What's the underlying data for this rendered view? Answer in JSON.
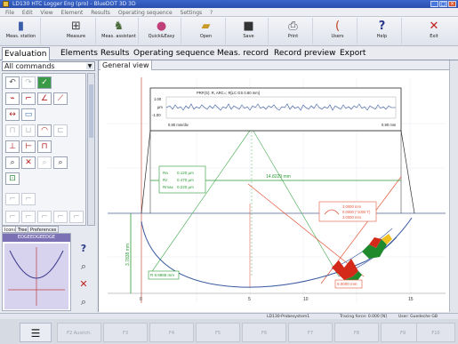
{
  "window": {
    "title": "LD130 HTC Logger Eng (pro) - BlueDOT 3D 3D",
    "controls": {
      "min": "_",
      "max": "□",
      "close": "×"
    }
  },
  "menu": [
    "File",
    "Edit",
    "View",
    "Element",
    "Results",
    "Operating sequence",
    "Settings",
    "?"
  ],
  "toolbar": [
    {
      "label": "Meas. station",
      "icon": "meas-station-icon"
    },
    {
      "label": "Measure",
      "icon": "measure-icon"
    },
    {
      "label": "Meas. assistant",
      "icon": "assistant-icon"
    },
    {
      "label": "Quick&Easy",
      "icon": "quick-easy-icon"
    },
    {
      "label": "Open",
      "icon": "open-icon"
    },
    {
      "label": "Save",
      "icon": "save-icon"
    },
    {
      "label": "Print",
      "icon": "print-icon"
    },
    {
      "label": "Users",
      "icon": "users-icon"
    },
    {
      "label": "Help",
      "icon": "help-icon"
    },
    {
      "label": "Exit",
      "icon": "exit-icon"
    }
  ],
  "tabs": [
    "Evaluation",
    "Elements",
    "Results",
    "Operating sequence",
    "Meas. record",
    "Record preview",
    "Export"
  ],
  "active_tab": "Evaluation",
  "commands_dropdown": "All commands",
  "view_title": "General view",
  "subtabs": [
    "Icons",
    "Tree",
    "Preferences"
  ],
  "thumbnail_header": "EDGEEDGEEDGE",
  "profile_inset": {
    "title": "PRF(G): R, ARC=; R[LC GS 0.80 mm]",
    "y_top": "1.00",
    "y_unit": "µm",
    "y_bottom": "-1.00",
    "x_left": "0.80 mm/div",
    "x_right": "0.90 mm"
  },
  "measure_box": {
    "rows": [
      {
        "label": "Ra",
        "value": "0.120 µm"
      },
      {
        "label": "Rz",
        "value": "0.470 µm"
      },
      {
        "label": "Rmax",
        "value": "0.220 µm"
      }
    ]
  },
  "dimensions": {
    "horizontal": "14.8229 mm",
    "vertical": "3.7838 mm",
    "radius": "R 8.9988 mm",
    "arc_box": [
      "3.0000 mm",
      "0.0000 (*1000 T)",
      "3.0000 mm"
    ],
    "corner": "9.0000 mm"
  },
  "axis_ticks": [
    "0",
    "5",
    "10",
    "15"
  ],
  "status": {
    "system": "LD130-Probesystem1",
    "force": "Tracing force: 0.000 [N]",
    "user": "User: Guedeche GB"
  },
  "fkeys": [
    "F2 Ausrich.",
    "F3",
    "F4",
    "F5",
    "F6",
    "F7",
    "F8",
    "F9",
    "F10"
  ],
  "colors": {
    "title_bar": "#2b4fae",
    "tab_active": "#ffffff",
    "profile_line": "#3a5aa0",
    "dimension_green": "#2a9a35",
    "dimension_red": "#e4553a",
    "highlight_green": "#1e8a2c",
    "highlight_red": "#d42a1a"
  }
}
